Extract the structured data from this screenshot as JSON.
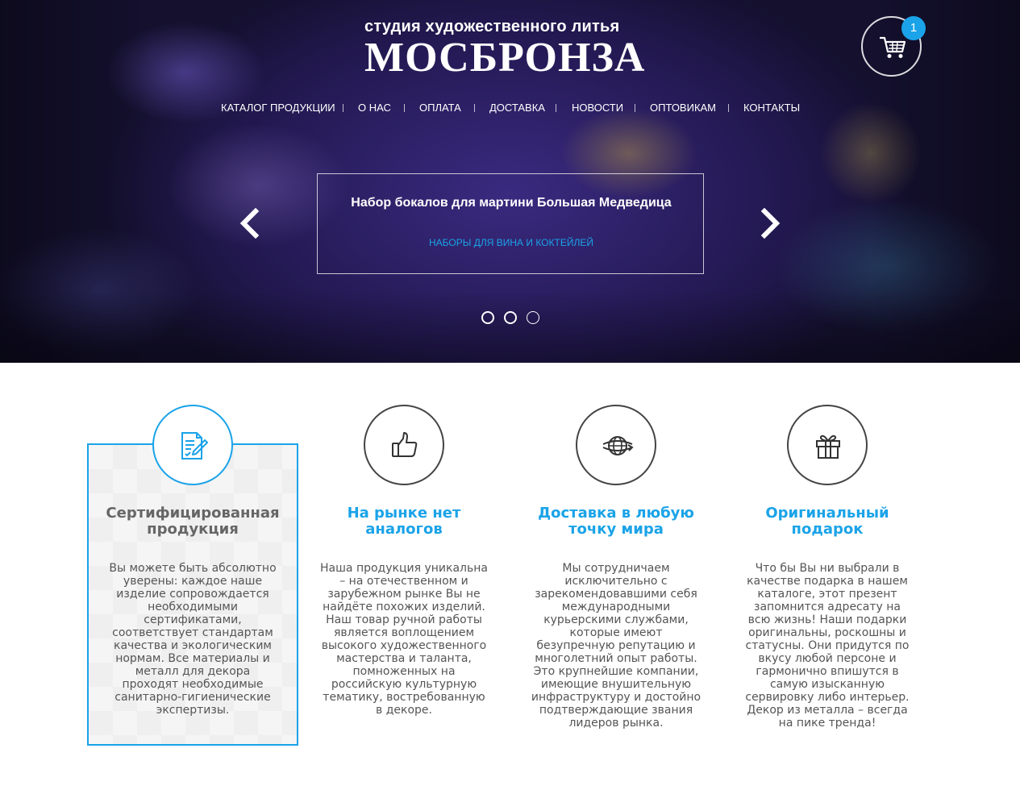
{
  "header": {
    "logo_subtitle": "студия художественного литья",
    "logo_title": "МОСБРОНЗА",
    "cart_count": "1",
    "cart_icon": "cart-icon"
  },
  "nav": {
    "items": [
      {
        "label": "КАТАЛОГ ПРОДУКЦИИ"
      },
      {
        "label": "О НАС"
      },
      {
        "label": "ОПЛАТА"
      },
      {
        "label": "ДОСТАВКА"
      },
      {
        "label": "НОВОСТИ"
      },
      {
        "label": "ОПТОВИКАМ"
      },
      {
        "label": "КОНТАКТЫ"
      }
    ]
  },
  "slider": {
    "title": "Набор бокалов для мартини Большая Медведица",
    "category": "НАБОРЫ ДЛЯ ВИНА И КОКТЕЙЛЕЙ",
    "prev_icon": "chevron-left-icon",
    "next_icon": "chevron-right-icon",
    "dots_count": 3,
    "active_dot": 3
  },
  "features": [
    {
      "icon": "certificate-icon",
      "title": "Сертифицированная продукция",
      "text": "Вы можете быть абсолютно уверены: каждое наше изделие сопровождается необходимыми сертификатами, соответствует стандартам качества и экологическим нормам. Все материалы и металл для декора проходят необходимые санитарно-гигиенические экспертизы."
    },
    {
      "icon": "thumbs-up-icon",
      "title": "На рынке нет аналогов",
      "text": "Наша продукция уникальна – на отечественном и зарубежном рынке Вы не найдёте похожих изделий. Наш товар ручной работы является воплощением высокого художественного мастерства и таланта, помноженных на российскую культурную тематику, востребованную в декоре."
    },
    {
      "icon": "globe-delivery-icon",
      "title": "Доставка в любую точку мира",
      "text": "Мы сотрудничаем исключительно с зарекомендовавшими себя международными курьерскими службами, которые имеют безупречную репутацию и многолетний опыт работы. Это крупнейшие компании, имеющие внушительную инфраструктуру и достойно подтверждающие звания лидеров рынка."
    },
    {
      "icon": "gift-icon",
      "title": "Оригинальный подарок",
      "text": "Что бы Вы ни выбрали в качестве подарка в нашем каталоге, этот презент запомнится адресату на всю жизнь! Наши подарки оригинальны, роскошны и статусны. Они придутся по вкусу любой персоне и гармонично впишутся в самую изысканную сервировку либо интерьер. Декор из металла – всегда на пике тренда!"
    }
  ],
  "colors": {
    "accent": "#1aa3e8",
    "hero_bg": "#2a1e60"
  }
}
